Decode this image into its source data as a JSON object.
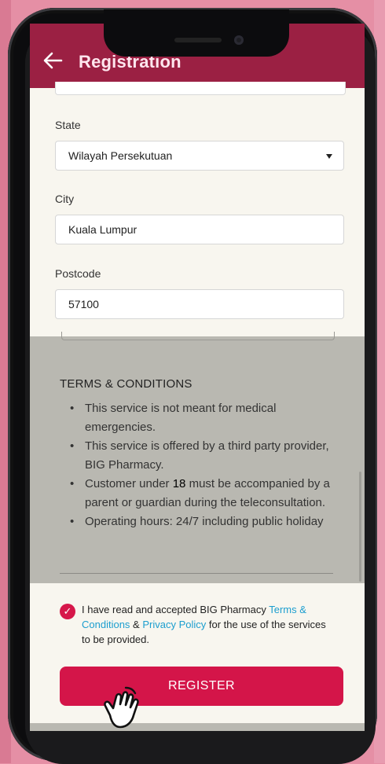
{
  "header": {
    "title": "Registration"
  },
  "form": {
    "state": {
      "label": "State",
      "value": "Wilayah Persekutuan"
    },
    "city": {
      "label": "City",
      "value": "Kuala Lumpur"
    },
    "postcode": {
      "label": "Postcode",
      "value": "57100"
    }
  },
  "terms": {
    "title": "TERMS & CONDITIONS",
    "items": {
      "0": "This service is not meant for medical emergencies.",
      "1": "This service is offered by a third party provider, BIG Pharmacy.",
      "2_pre": "Customer under ",
      "2_age": "18",
      "2_post": " must be accompanied by a parent or guardian during the teleconsultation.",
      "3": "Operating hours: 24/7 including public holiday"
    }
  },
  "consent": {
    "checked_icon": "check-icon",
    "pre": "I have read and accepted BIG Pharmacy ",
    "terms_link": "Terms & Conditions",
    "amp": " & ",
    "privacy_link": "Privacy Policy",
    "post": " for the use of the services to be provided."
  },
  "register_button": "REGISTER",
  "colors": {
    "header": "#9b2043",
    "primary": "#d41549",
    "link": "#1c9ecf",
    "background": "#e58fa5"
  }
}
